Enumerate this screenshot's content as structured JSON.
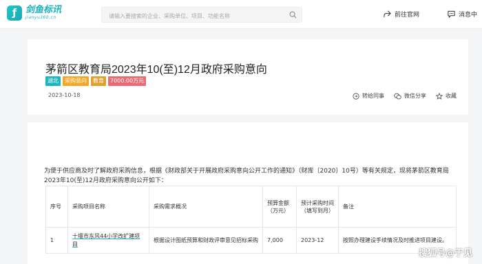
{
  "header": {
    "logo_name": "剑鱼标讯",
    "logo_sub": "jianyu360.cn",
    "search_placeholder": "请输入要搜索的企业、采购单位、项目、功能名称",
    "official_site": "前往官网",
    "messages": "消息中"
  },
  "notice": {
    "title": "茅箭区教育局2023年10(至)12月政府采购意向",
    "tags": [
      "湖北",
      "采购意向",
      "教育",
      "7000.00万元"
    ],
    "date": "2023-10-18",
    "actions": {
      "forward": "转给同事",
      "wechat_share": "微信分享",
      "favorite": "收藏"
    }
  },
  "body": {
    "intro": "为便于供应商及时了解政府采购信息，根据《财政部关于开展政府采购意向公开工作的通知》（财库〔2020〕10号）等有关规定，现将茅箭区教育局2023年10(至)12月政府采购意向公开如下：",
    "table": {
      "headers": [
        "序号",
        "采购项目名称",
        "采购需求概况",
        "预算金额（万元）",
        "预计采购时间（填写到月）",
        "备注"
      ],
      "rows": [
        [
          "1",
          "十堰市东风44小学改扩建项目",
          "根据设计图纸预算和财政评审意见招标采购",
          "7,000",
          "2023-12",
          "按照办理建设手续情况及时推进项目建设。"
        ]
      ]
    }
  },
  "watermark": "搜狐号@于见",
  "colors": {
    "brand": "#1bb5bd",
    "tag_orange": "#f5a623",
    "tag_gold": "#e0a02b",
    "tag_red": "#ec6a74"
  }
}
